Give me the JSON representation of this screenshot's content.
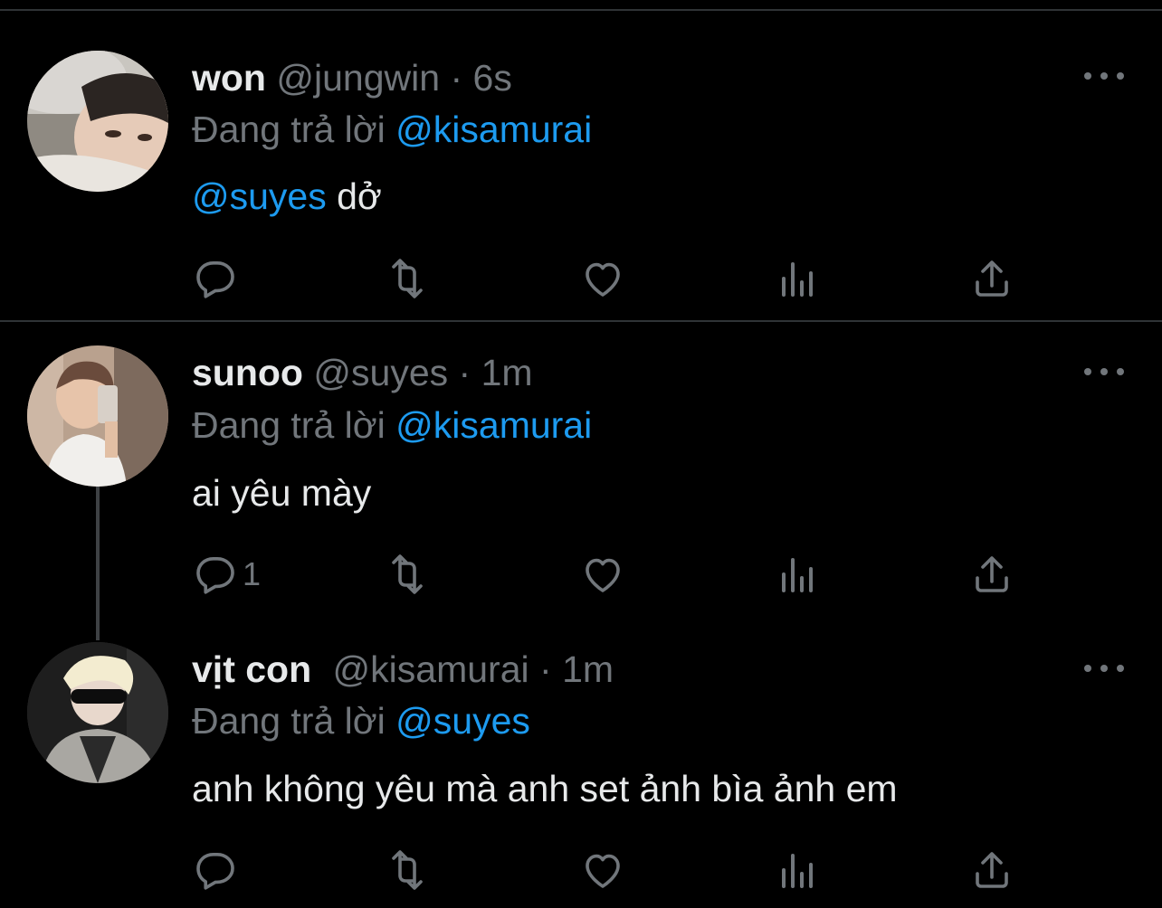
{
  "colors": {
    "background": "#000000",
    "text": "#e7e9ea",
    "secondary": "#71767b",
    "accent": "#1d9bf0",
    "divider": "#2f3336"
  },
  "tweets": [
    {
      "name": "won",
      "handle": "@jungwin",
      "dot": "·",
      "time": "6s",
      "replying_prefix": "Đang trả lời",
      "replying_to": "@kisamurai",
      "body_mention": "@suyes",
      "body_text": " dở",
      "reply_count": "",
      "actions": [
        "reply-icon",
        "retweet-icon",
        "like-icon",
        "analytics-icon",
        "share-icon"
      ]
    },
    {
      "name": "sunoo",
      "handle": "@suyes",
      "dot": "·",
      "time": "1m",
      "replying_prefix": "Đang trả lời",
      "replying_to": "@kisamurai",
      "body_mention": "",
      "body_text": "ai yêu mày",
      "reply_count": "1",
      "actions": [
        "reply-icon",
        "retweet-icon",
        "like-icon",
        "analytics-icon",
        "share-icon"
      ]
    },
    {
      "name": "vịt con",
      "handle": "@kisamurai",
      "dot": "·",
      "time": "1m",
      "replying_prefix": "Đang trả lời",
      "replying_to": "@suyes",
      "body_mention": "",
      "body_text": "anh không yêu mà anh set ảnh bìa ảnh em",
      "reply_count": "",
      "actions": [
        "reply-icon",
        "retweet-icon",
        "like-icon",
        "analytics-icon",
        "share-icon"
      ]
    }
  ]
}
